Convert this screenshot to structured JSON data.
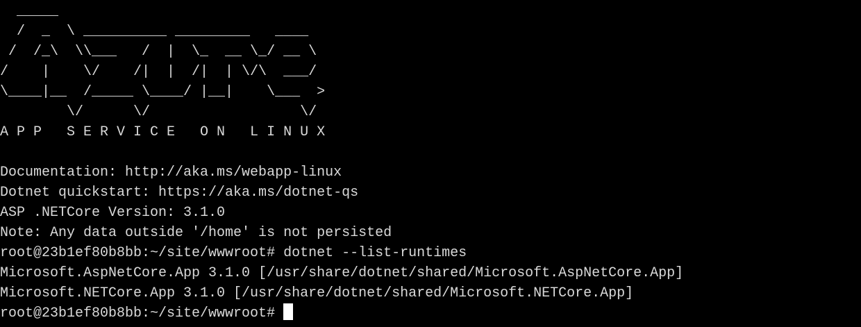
{
  "terminal": {
    "banner": [
      "  _____",
      "  /  _  \\ __________ _________   ____",
      " /  /_\\  \\\\___   /  |  \\_  __ \\_/ __ \\",
      "/    |    \\/    /|  |  /|  | \\/\\  ___/",
      "\\____|__  /_____ \\____/ |__|    \\___  >",
      "        \\/      \\/                  \\/",
      "A P P   S E R V I C E   O N   L I N U X"
    ],
    "info": [
      "Documentation: http://aka.ms/webapp-linux",
      "Dotnet quickstart: https://aka.ms/dotnet-qs",
      "ASP .NETCore Version: 3.1.0",
      "Note: Any data outside '/home' is not persisted"
    ],
    "command": {
      "prompt": "root@23b1ef80b8bb:~/site/wwwroot# ",
      "text": "dotnet --list-runtimes"
    },
    "output": [
      "Microsoft.AspNetCore.App 3.1.0 [/usr/share/dotnet/shared/Microsoft.AspNetCore.App]",
      "Microsoft.NETCore.App 3.1.0 [/usr/share/dotnet/shared/Microsoft.NETCore.App]"
    ],
    "current_prompt": "root@23b1ef80b8bb:~/site/wwwroot# "
  },
  "colors": {
    "background": "#000000",
    "text": "#d9d9d9",
    "cursor": "#ffffff"
  }
}
